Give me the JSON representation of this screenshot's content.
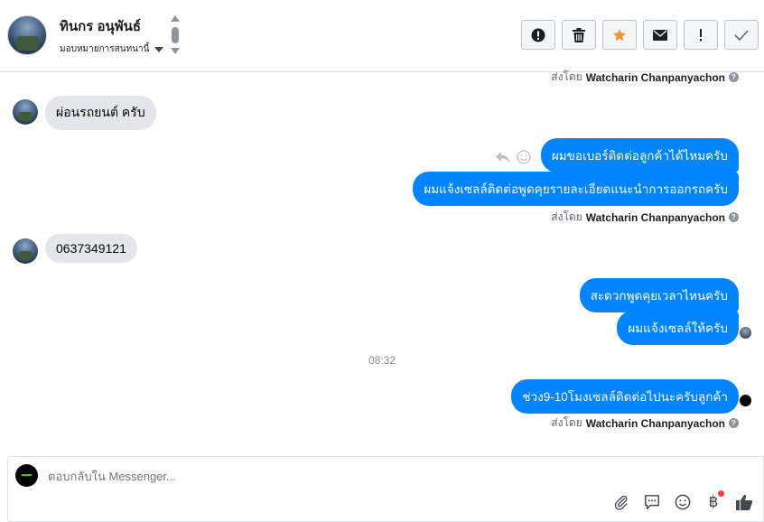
{
  "header": {
    "contact_name": "ทินกร อนุพันธ์",
    "assigned_label": "มอบหมายการสนทนานี้",
    "toolbar": [
      {
        "name": "spam-button",
        "icon": "alert-circle-icon"
      },
      {
        "name": "delete-button",
        "icon": "trash-icon"
      },
      {
        "name": "star-button",
        "icon": "star-icon",
        "color": "#f7923b"
      },
      {
        "name": "mark-unread-button",
        "icon": "envelope-icon"
      },
      {
        "name": "flag-button",
        "icon": "exclamation-icon"
      },
      {
        "name": "mark-done-button",
        "icon": "check-icon"
      }
    ]
  },
  "thread": {
    "sent_by_prefix": "ส่งโดย",
    "sent_by_name": "Watcharin Chanpanyachon",
    "help_glyph": "?",
    "messages": [
      {
        "dir": "in",
        "text": "ผ่อนรถยนต์ ครับ"
      },
      {
        "dir": "out",
        "text": "ผมขอเบอร์ติดต่อลูกค้าได้ไหมครับ"
      },
      {
        "dir": "out",
        "text": "ผมแจ้งเซลล์ติดต่อพูดคุยรายละเอียดแนะนำการออกรถครับ"
      },
      {
        "dir": "in",
        "text": "0637349121"
      },
      {
        "dir": "out",
        "text": "สะดวกพูดคุยเวลาไหนครับ"
      },
      {
        "dir": "out",
        "text": "ผมแจ้งเซลล์ให้ครับ"
      },
      {
        "dir": "out",
        "text": "ช่วง9-10โมงเซลล์ติดต่อไปนะครับลูกค้า"
      }
    ],
    "timestamp": "08:32"
  },
  "composer": {
    "placeholder": "ตอบกลับใน Messenger...",
    "baht_glyph": "฿",
    "icons": [
      "attachment-icon",
      "saved-reply-icon",
      "emoji-icon",
      "payment-icon",
      "thumbs-up-icon"
    ]
  },
  "colors": {
    "outgoing_bubble": "#0084ff",
    "incoming_bubble": "#e4e6eb",
    "star": "#f7923b",
    "notification_dot": "#fa3e3e"
  }
}
